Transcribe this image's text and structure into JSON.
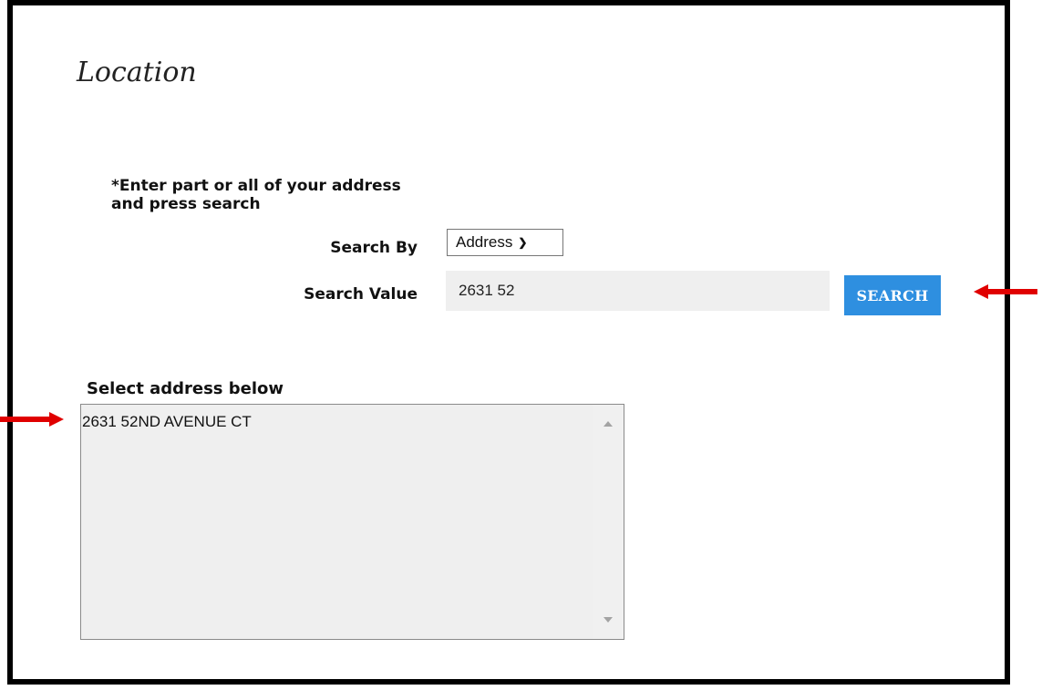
{
  "page": {
    "title": "Location",
    "instructions": "*Enter part or all of your address and press search"
  },
  "search": {
    "by_label": "Search By",
    "by_selected": "Address",
    "value_label": "Search Value",
    "value": "2631 52",
    "button_label": "SEARCH"
  },
  "results": {
    "label": "Select address below",
    "items": [
      "2631 52ND AVENUE CT"
    ]
  },
  "icons": {
    "chevron": "chevron-down-icon",
    "arrows": [
      "red-arrow-left-icon",
      "red-arrow-right-icon"
    ]
  },
  "colors": {
    "accent": "#2e8fe0",
    "arrow": "#e00000",
    "input_bg": "#efefef"
  }
}
